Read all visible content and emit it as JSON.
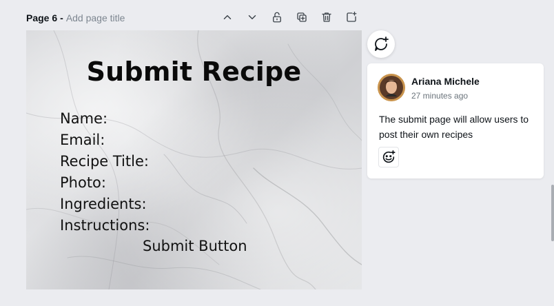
{
  "page_header": {
    "page_label": "Page 6",
    "separator": "-",
    "title_placeholder": "Add page title"
  },
  "toolbar": {
    "icons": [
      "chevron-up-icon",
      "chevron-down-icon",
      "unlock-icon",
      "duplicate-icon",
      "trash-icon",
      "add-page-icon"
    ]
  },
  "canvas": {
    "title": "Submit Recipe",
    "fields": [
      "Name:",
      "Email:",
      "Recipe Title:",
      "Photo:",
      "Ingredients:",
      "Instructions:"
    ],
    "submit": "Submit Button"
  },
  "comment": {
    "author": "Ariana Michele",
    "timestamp": "27 minutes ago",
    "text": "The submit page will allow users to post their own recipes"
  },
  "colors": {
    "background": "#ebecf0",
    "card": "#ffffff",
    "text": "#0e1318",
    "muted": "#7d8690"
  }
}
